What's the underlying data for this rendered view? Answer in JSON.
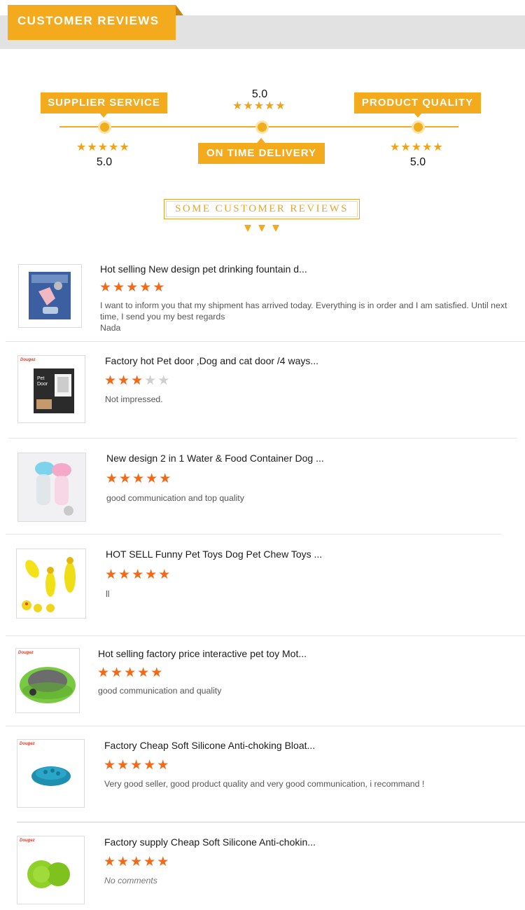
{
  "header": {
    "title": "CUSTOMER REVIEWS"
  },
  "ratings": {
    "supplier_service": {
      "label": "SUPPLIER SERVICE",
      "score": "5.0",
      "stars": 5
    },
    "on_time_delivery": {
      "label": "ON TIME DELIVERY",
      "score": "5.0",
      "stars": 5
    },
    "product_quality": {
      "label": "PRODUCT QUALITY",
      "score": "5.0",
      "stars": 5
    }
  },
  "section_title": "SOME CUSTOMER REVIEWS",
  "colors": {
    "accent": "#f3aa1c",
    "star": "#f26a17",
    "star_off": "#cfcfcf"
  },
  "reviews": [
    {
      "title": "Hot selling New design pet drinking fountain d...",
      "stars": 5,
      "comment": "I want to inform you that my shipment has arrived today. Everything is in order and I am satisfied. Until next time, I send you my best regards",
      "reviewer": "Nada",
      "image": "pet-drinking-fountain-product-image"
    },
    {
      "title": "Factory hot Pet door ,Dog and cat door /4 ways...",
      "stars": 3,
      "comment": "Not impressed.",
      "brand": "Dougez",
      "image": "pet-door-box-product-image",
      "box_label": "Pet Door"
    },
    {
      "title": "New design 2 in 1 Water & Food Container Dog ...",
      "stars": 5,
      "comment": "good communication and top quality",
      "image": "water-food-container-product-image"
    },
    {
      "title": "HOT SELL Funny Pet Toys Dog Pet Chew Toys ...",
      "stars": 5,
      "comment": "ll",
      "image": "rubber-chicken-toys-product-image"
    },
    {
      "title": "Hot selling factory price interactive pet toy Mot...",
      "stars": 5,
      "comment": "good communication and quality",
      "brand": "Dougez",
      "image": "cat-scratch-toy-product-image"
    },
    {
      "title": "Factory Cheap Soft Silicone Anti-choking Bloat...",
      "stars": 5,
      "comment": "Very good seller, good product quality and very good communication, i recommand !",
      "brand": "Dougez",
      "image": "silicone-slow-feeder-product-image"
    },
    {
      "title": "Factory supply Cheap Soft Silicone Anti-chokin...",
      "stars": 5,
      "comment": "No comments",
      "brand": "Dougez",
      "image": "silicone-lick-mat-product-image"
    }
  ]
}
